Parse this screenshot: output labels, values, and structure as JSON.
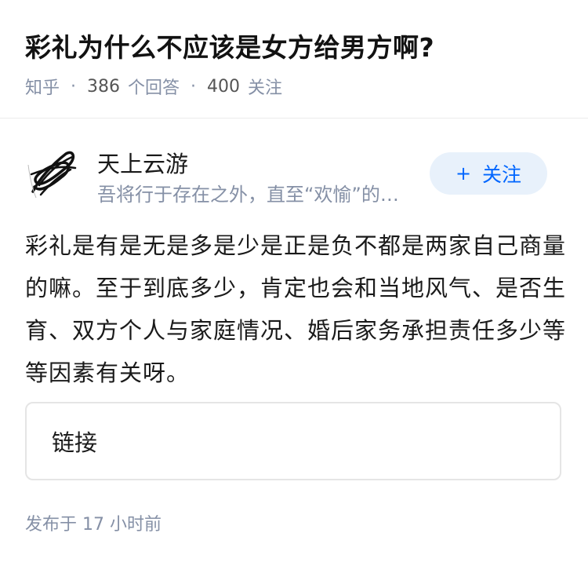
{
  "question": {
    "title": "彩礼为什么不应该是女方给男方啊?",
    "source": "知乎",
    "answer_count": "386",
    "answer_label": "个回答",
    "follower_count": "400",
    "follower_label": "关注"
  },
  "author": {
    "name": "天上云游",
    "bio": "吾将行于存在之外，直至“欢愉”的…",
    "avatar_icon": "signature-scribble-avatar"
  },
  "follow_button": {
    "icon": "plus-icon",
    "label": "关注",
    "color": "#0066ff",
    "background": "#e8f1fb"
  },
  "answer": {
    "content": "彩礼是有是无是多是少是正是负不都是两家自己商量的嘛。至于到底多少，肯定也会和当地风气、是否生育、双方个人与家庭情况、婚后家务承担责任多少等等因素有关呀。"
  },
  "link_card": {
    "label": "链接"
  },
  "publish": {
    "text": "发布于  17 小时前"
  }
}
